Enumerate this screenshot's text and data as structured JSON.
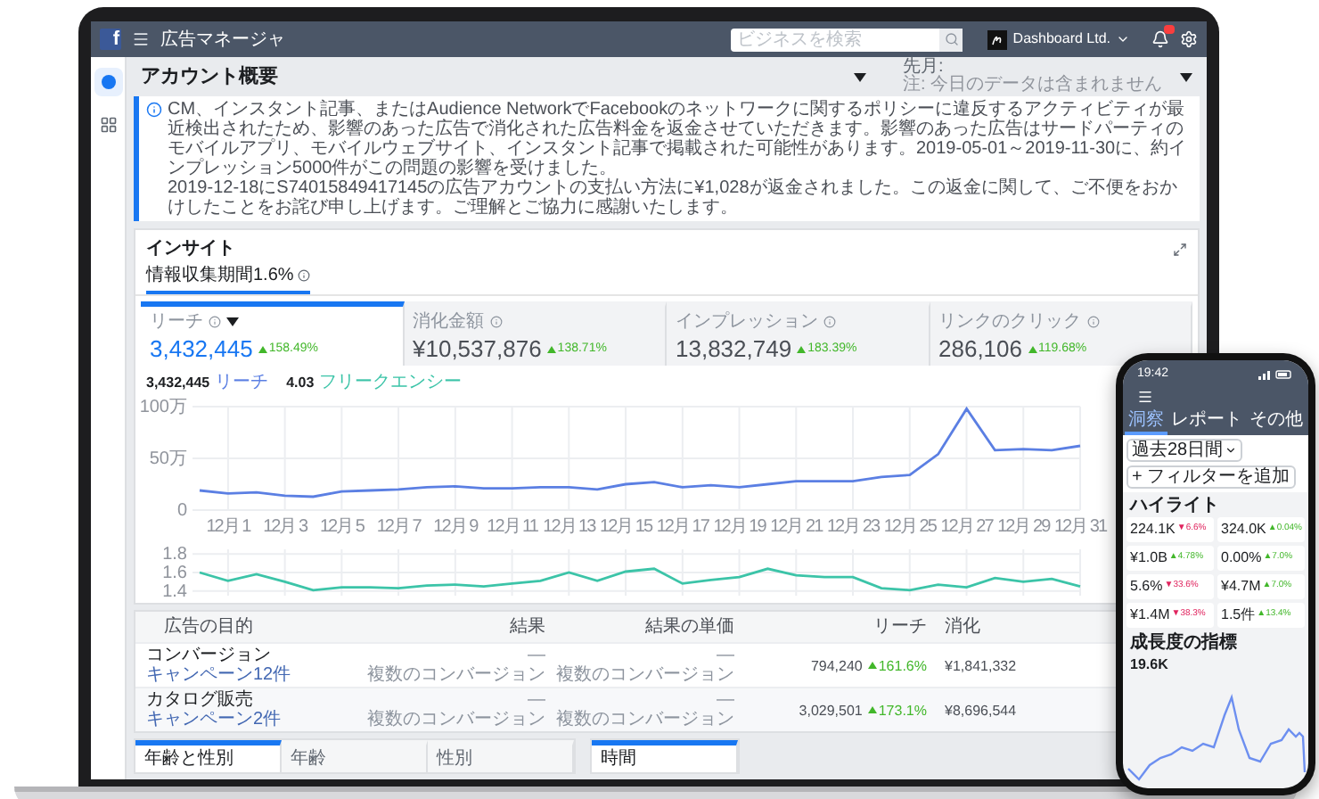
{
  "topbar": {
    "logo": "f",
    "app_title": "広告マネージャ",
    "search": {
      "placeholder": "ビジネスを検索"
    },
    "account": "Dashboard Ltd.",
    "notifications_badge": true
  },
  "sidebar": {
    "items": [
      {
        "kind": "home",
        "selected": true
      },
      {
        "kind": "grid",
        "selected": false
      }
    ]
  },
  "page_header": {
    "title": "アカウント概要",
    "period_label": "先月:",
    "period_note": "注: 今日のデータは含まれません"
  },
  "notice": {
    "paragraphs": [
      "CM、インスタント記事、またはAudience NetworkでFacebookのネットワークに関するポリシーに違反するアクティビティが最近検出されたため、影響のあった広告で消化された広告料金を返金させていただきます。影響のあった広告はサードパーティのモバイルアプリ、モバイルウェブサイト、インスタント記事で掲載された可能性があります。2019-05-01～2019-11-30に、約インプレッション5000件がこの問題の影響を受けました。",
      "2019-12-18にS74015849417145の広告アカウントの支払い方法に¥1,028が返金されました。この返金に関して、ご不便をおかけしたことをお詫び申し上げます。ご理解とご協力に感謝いたします。"
    ]
  },
  "insights": {
    "title": "インサイト",
    "tabs": [
      {
        "label": "情報収集期間1.6%",
        "selected": true
      }
    ],
    "metrics": [
      {
        "label": "リーチ",
        "value": "3,432,445",
        "change": "158.49%",
        "selected": true,
        "has_dropdown": true
      },
      {
        "label": "消化金額",
        "value": "¥10,537,876",
        "change": "138.71%",
        "selected": false,
        "has_dropdown": false
      },
      {
        "label": "インプレッション",
        "value": "13,832,749",
        "change": "183.39%",
        "selected": false,
        "has_dropdown": false
      },
      {
        "label": "リンクのクリック",
        "value": "286,106",
        "change": "119.68%",
        "selected": false,
        "has_dropdown": false
      }
    ],
    "legend_values": [
      "3,432,445",
      "4.03"
    ],
    "charts": [
      {
        "chart_data": {
          "type": "line",
          "grid": true,
          "categories": [
            null,
            "12月 1",
            null,
            "12月 3",
            null,
            "12月 5",
            null,
            "12月 7",
            null,
            "12月 9",
            null,
            "12月 11",
            null,
            "12月 13",
            null,
            "12月 15",
            null,
            "12月 17",
            null,
            "12月 19",
            null,
            "12月 21",
            null,
            "12月 23",
            null,
            "12月 25",
            null,
            "12月 27",
            null,
            "12月 29",
            null,
            "12月 31"
          ],
          "series": [
            {
              "name": "リーチ",
              "color": "#5b7fe3",
              "values": [
                19,
                16,
                17,
                14,
                13,
                18,
                19,
                20,
                22,
                23,
                21,
                21,
                22,
                22,
                20,
                25,
                27,
                22,
                24,
                22,
                25,
                28,
                28,
                28,
                32,
                34,
                54,
                98,
                58,
                59,
                58,
                62
              ]
            }
          ],
          "ylim": [
            0,
            100
          ],
          "yticks": [
            {
              "value": 0,
              "label": "0"
            },
            {
              "value": 50,
              "label": "50万"
            },
            {
              "value": 100,
              "label": "100万"
            }
          ]
        }
      },
      {
        "chart_data": {
          "type": "line",
          "grid": true,
          "series": [
            {
              "name": "フリークエンシー",
              "color": "#3cc4a8",
              "values": [
                1.6,
                1.51,
                1.58,
                1.5,
                1.41,
                1.44,
                1.44,
                1.43,
                1.46,
                1.47,
                1.45,
                1.48,
                1.51,
                1.6,
                1.51,
                1.61,
                1.64,
                1.48,
                1.52,
                1.55,
                1.64,
                1.57,
                1.55,
                1.55,
                1.43,
                1.41,
                1.47,
                1.44,
                1.54,
                1.5,
                1.53,
                1.45
              ]
            }
          ],
          "ylim": [
            1.35,
            1.85
          ],
          "yticks": [
            1.4,
            1.6,
            1.8
          ]
        }
      }
    ]
  },
  "table": {
    "columns": [
      "広告の目的",
      "結果",
      "結果の単価",
      "リーチ",
      "消化"
    ],
    "rows": [
      {
        "objective": "コンバージョン",
        "campaigns": "キャンペーン12件",
        "result": "—",
        "result_note": "複数のコンバージョン",
        "cost": "—",
        "cost_note": "複数のコンバージョン",
        "reach": "794,240",
        "reach_change": "161.6%",
        "spend": "¥1,841,332"
      },
      {
        "objective": "カタログ販売",
        "campaigns": "キャンペーン2件",
        "result": "—",
        "result_note": "複数のコンバージョン",
        "cost": "—",
        "cost_note": "複数のコンバージョン",
        "reach": "3,029,501",
        "reach_change": "173.1%",
        "spend": "¥8,696,544"
      }
    ]
  },
  "breakdown_tabs": [
    {
      "label": "年齢と性別",
      "selected": true
    },
    {
      "label": "年齢",
      "selected": false
    },
    {
      "label": "性別",
      "selected": false
    }
  ],
  "time_tabs": [
    {
      "label": "時間",
      "selected": true
    }
  ],
  "phone": {
    "time": "19:42",
    "tabs": [
      {
        "label": "洞察",
        "selected": true
      },
      {
        "label": "レポート",
        "selected": false
      },
      {
        "label": "その他",
        "selected": false
      }
    ],
    "date_filter": "過去28日間",
    "add_filter": "+ フィルターを追加",
    "highlights_title": "ハイライト",
    "cards": [
      {
        "value": "224.1K",
        "arrow": "▼",
        "change": "6.6%",
        "color": "#e0245e"
      },
      {
        "value": "324.0K",
        "arrow": "▲",
        "change": "0.04%",
        "color": "#42b72a"
      },
      {
        "value": "¥1.0B",
        "arrow": "▲",
        "change": "4.78%",
        "color": "#42b72a"
      },
      {
        "value": "0.00%",
        "arrow": "▲",
        "change": "7.0%",
        "color": "#42b72a"
      },
      {
        "value": "5.6%",
        "arrow": "▼",
        "change": "33.6%",
        "color": "#e0245e"
      },
      {
        "value": "¥4.7M",
        "arrow": "▲",
        "change": "7.0%",
        "color": "#42b72a"
      },
      {
        "value": "¥1.4M",
        "arrow": "▼",
        "change": "38.3%",
        "color": "#e0245e"
      },
      {
        "value": "1.5件",
        "arrow": "▲",
        "change": "13.4%",
        "color": "#42b72a"
      }
    ],
    "growth_title": "成長度の指標",
    "growth_value": "19.6K"
  }
}
